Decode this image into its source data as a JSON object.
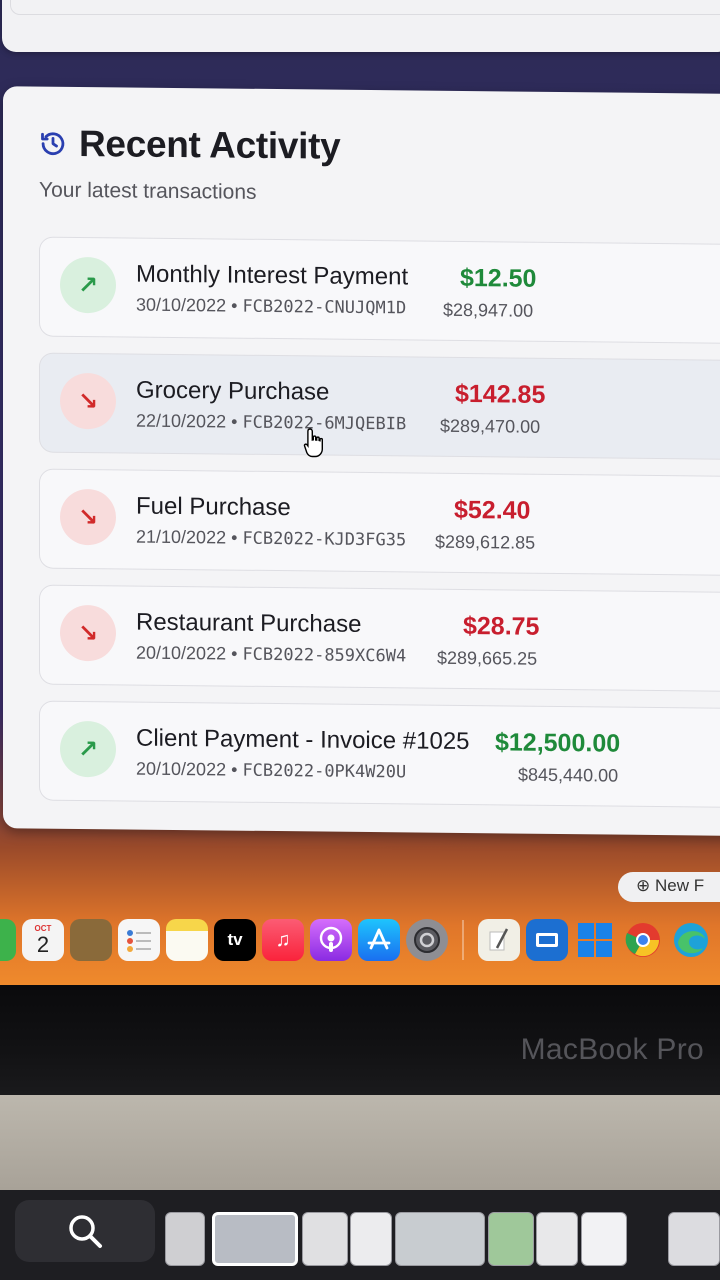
{
  "card": {
    "title": "Recent Activity",
    "subtitle": "Your latest transactions"
  },
  "transactions": [
    {
      "name": "Monthly Interest Payment",
      "date": "30/10/2022",
      "ref": "FCB2022-CNUJQM1D",
      "amount": "$12.50",
      "balance": "$28,947.00",
      "direction": "in"
    },
    {
      "name": "Grocery Purchase",
      "date": "22/10/2022",
      "ref": "FCB2022-6MJQEBIB",
      "amount": "$142.85",
      "balance": "$289,470.00",
      "direction": "out"
    },
    {
      "name": "Fuel Purchase",
      "date": "21/10/2022",
      "ref": "FCB2022-KJD3FG35",
      "amount": "$52.40",
      "balance": "$289,612.85",
      "direction": "out"
    },
    {
      "name": "Restaurant Purchase",
      "date": "20/10/2022",
      "ref": "FCB2022-859XC6W4",
      "amount": "$28.75",
      "balance": "$289,665.25",
      "direction": "out"
    },
    {
      "name": "Client Payment - Invoice #1025",
      "date": "20/10/2022",
      "ref": "FCB2022-0PK4W20U",
      "amount": "$12,500.00",
      "balance": "$845,440.00",
      "direction": "in"
    }
  ],
  "separator": "•",
  "new_button": "New F",
  "dock": {
    "calendar_month": "OCT",
    "calendar_day": "2",
    "tv_label": "tv"
  },
  "device_label": "MacBook Pro",
  "colors": {
    "income": "#1f8a3a",
    "expense": "#c81e2e",
    "income_bg": "#d9f0de",
    "expense_bg": "#f8dcdc"
  }
}
